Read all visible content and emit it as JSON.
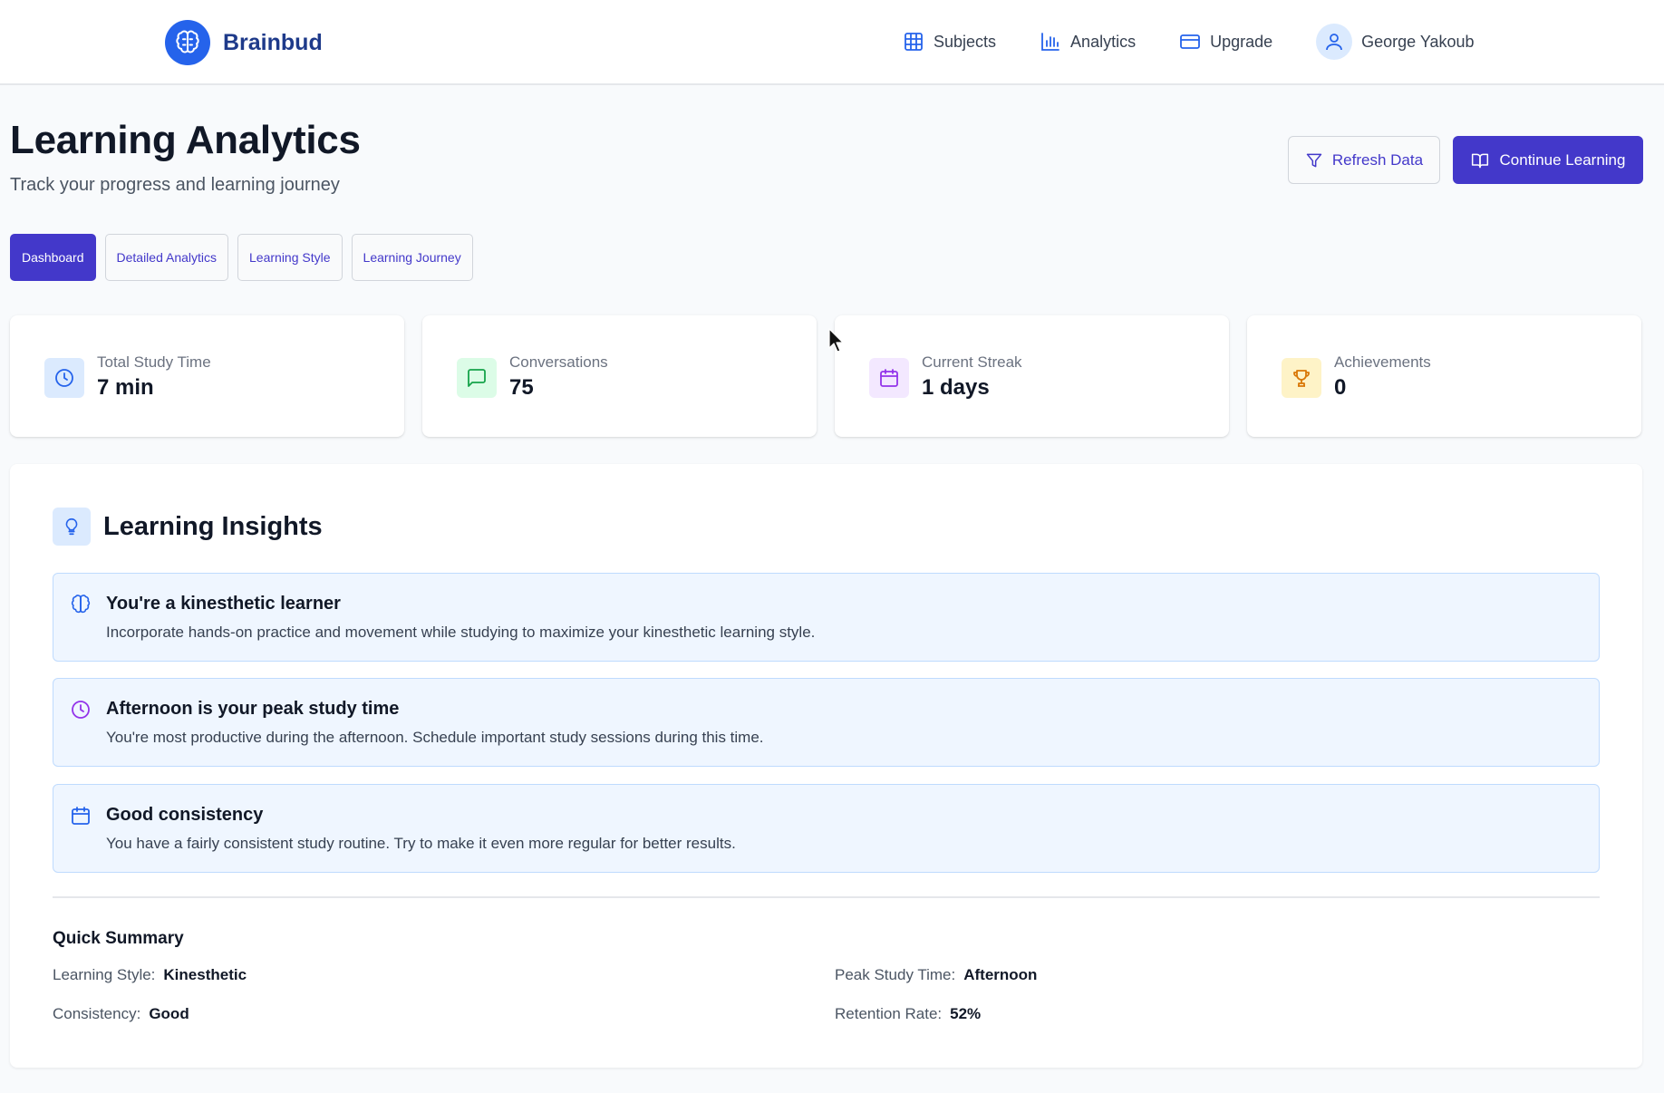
{
  "header": {
    "brand": "Brainbud",
    "nav": [
      {
        "label": "Subjects",
        "icon": "grid-icon"
      },
      {
        "label": "Analytics",
        "icon": "bar-chart-icon"
      },
      {
        "label": "Upgrade",
        "icon": "credit-card-icon"
      }
    ],
    "user_name": "George Yakoub"
  },
  "page": {
    "title": "Learning Analytics",
    "subtitle": "Track your progress and learning journey",
    "refresh_label": "Refresh Data",
    "continue_label": "Continue Learning"
  },
  "tabs": [
    {
      "label": "Dashboard",
      "active": true
    },
    {
      "label": "Detailed Analytics",
      "active": false
    },
    {
      "label": "Learning Style",
      "active": false
    },
    {
      "label": "Learning Journey",
      "active": false
    }
  ],
  "stats": [
    {
      "label": "Total Study Time",
      "value": "7 min",
      "icon": "clock-icon",
      "color": "#2563eb",
      "bg": "#dbeafe"
    },
    {
      "label": "Conversations",
      "value": "75",
      "icon": "message-icon",
      "color": "#16a34a",
      "bg": "#dcfce7"
    },
    {
      "label": "Current Streak",
      "value": "1 days",
      "icon": "calendar-icon",
      "color": "#9333ea",
      "bg": "#f3e8ff"
    },
    {
      "label": "Achievements",
      "value": "0",
      "icon": "trophy-icon",
      "color": "#d97706",
      "bg": "#fef3c7"
    }
  ],
  "insights": {
    "title": "Learning Insights",
    "items": [
      {
        "title": "You're a kinesthetic learner",
        "desc": "Incorporate hands-on practice and movement while studying to maximize your kinesthetic learning style.",
        "icon": "brain-icon",
        "color": "#2563eb"
      },
      {
        "title": "Afternoon is your peak study time",
        "desc": "You're most productive during the afternoon. Schedule important study sessions during this time.",
        "icon": "clock-icon",
        "color": "#9333ea"
      },
      {
        "title": "Good consistency",
        "desc": "You have a fairly consistent study routine. Try to make it even more regular for better results.",
        "icon": "calendar-icon",
        "color": "#2563eb"
      }
    ]
  },
  "summary": {
    "title": "Quick Summary",
    "learning_style_label": "Learning Style:",
    "learning_style_value": "Kinesthetic",
    "peak_label": "Peak Study Time:",
    "peak_value": "Afternoon",
    "consistency_label": "Consistency:",
    "consistency_value": "Good",
    "retention_label": "Retention Rate:",
    "retention_value": "52%"
  },
  "colors": {
    "primary": "#4338ca",
    "brand": "#2563eb"
  }
}
